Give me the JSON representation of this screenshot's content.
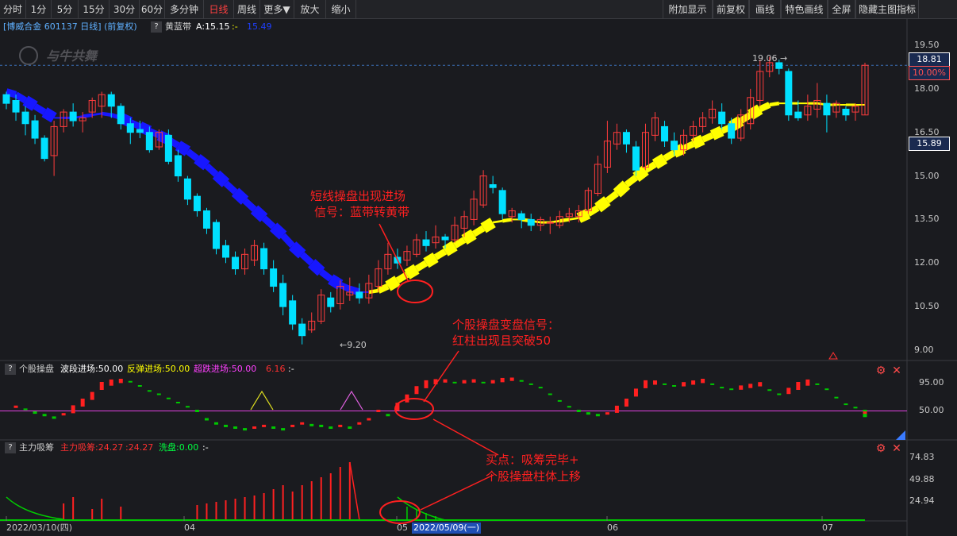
{
  "toolbar": {
    "left": [
      "分时",
      "1分",
      "5分",
      "15分",
      "30分",
      "60分",
      "多分钟",
      "日线",
      "周线",
      "更多▼",
      "放大",
      "缩小"
    ],
    "active": "日线",
    "right": [
      "附加显示",
      "前复权",
      "画线",
      "特色画线",
      "全屏",
      "隐藏主图指标"
    ]
  },
  "main": {
    "title": "[博威合金 601137 日线] (前复权)",
    "indicator": "黄蓝带",
    "a_value": "A:15.15",
    "colon": ":-",
    "last": "15.49",
    "high_label": "19.06",
    "low_label": "9.20",
    "price_tag_top": "18.81",
    "pct_tag": "10.00%",
    "price_tag_mid": "15.89",
    "axis": [
      "19.50",
      "18.00",
      "16.50",
      "15.00",
      "13.50",
      "12.00",
      "10.50",
      "9.00"
    ],
    "annot1": "短线操盘出现进场\n信号：蓝带转黄带",
    "watermark": "与牛共舞"
  },
  "panel1": {
    "name": "个股操盘",
    "a": "波段进场:50.00",
    "b": "反弹进场:50.00",
    "c": "超跌进场:50.00",
    "d": "6.16",
    "e": ":-",
    "axis": [
      "95.00",
      "50.00"
    ],
    "annot": "个股操盘变盘信号：\n红柱出现且突破50"
  },
  "panel2": {
    "name": "主力吸筹",
    "a": "主力吸筹:24.27",
    "b": ":24.27",
    "c": "洗盘:0.00",
    "d": ":-",
    "axis": [
      "74.83",
      "49.88",
      "24.94"
    ],
    "annot": "买点：吸筹完毕+\n个股操盘柱体上移"
  },
  "dates": {
    "start": "2022/03/10(四)",
    "m04": "04",
    "m05": "05",
    "cursor": "2022/05/09(一)",
    "m06": "06",
    "m07": "07"
  },
  "colors": {
    "up": "#ff3c3c",
    "down": "#00e0ff",
    "blue_band": "#1717ff",
    "yellow_band": "#ffff00",
    "magenta": "#e040e0",
    "green": "#00c800",
    "annot": "#ff2020"
  },
  "chart_data": {
    "type": "candlestick",
    "ylim": [
      8.9,
      20.0
    ],
    "candles": [
      [
        17.8,
        17.5,
        17.9,
        17.3
      ],
      [
        17.6,
        17.2,
        17.8,
        16.9
      ],
      [
        17.2,
        16.8,
        17.4,
        16.4
      ],
      [
        16.9,
        16.3,
        17.1,
        16.1
      ],
      [
        16.3,
        15.6,
        16.4,
        15.5
      ],
      [
        15.7,
        16.7,
        16.9,
        15.0
      ],
      [
        16.7,
        17.2,
        17.3,
        16.5
      ],
      [
        17.2,
        16.9,
        17.5,
        16.7
      ],
      [
        16.9,
        17.0,
        17.2,
        16.5
      ],
      [
        17.2,
        17.6,
        17.7,
        17.0
      ],
      [
        17.4,
        17.8,
        17.9,
        17.0
      ],
      [
        17.8,
        17.4,
        17.9,
        17.0
      ],
      [
        17.4,
        16.8,
        17.5,
        16.6
      ],
      [
        16.8,
        16.5,
        17.0,
        16.1
      ],
      [
        16.6,
        16.5,
        16.9,
        16.3
      ],
      [
        16.5,
        15.9,
        16.7,
        15.8
      ],
      [
        16.0,
        16.5,
        16.6,
        15.9
      ],
      [
        16.4,
        15.5,
        16.6,
        15.4
      ],
      [
        15.7,
        15.0,
        15.9,
        14.8
      ],
      [
        14.9,
        14.2,
        15.0,
        14.0
      ],
      [
        14.3,
        13.8,
        14.4,
        13.6
      ],
      [
        13.8,
        13.2,
        13.9,
        13.0
      ],
      [
        13.4,
        12.5,
        13.5,
        12.3
      ],
      [
        12.6,
        12.2,
        12.8,
        12.0
      ],
      [
        12.2,
        11.8,
        12.4,
        11.6
      ],
      [
        11.8,
        12.3,
        12.5,
        11.6
      ],
      [
        12.1,
        12.6,
        12.8,
        11.9
      ],
      [
        12.5,
        11.8,
        12.7,
        11.6
      ],
      [
        11.8,
        11.2,
        12.1,
        11.0
      ],
      [
        11.3,
        10.5,
        11.6,
        10.2
      ],
      [
        10.7,
        9.9,
        10.9,
        9.7
      ],
      [
        9.9,
        9.5,
        10.1,
        9.2
      ],
      [
        9.7,
        10.0,
        10.3,
        9.6
      ],
      [
        10.0,
        10.9,
        11.1,
        9.9
      ],
      [
        10.8,
        10.5,
        11.0,
        10.3
      ],
      [
        10.6,
        11.2,
        11.4,
        10.4
      ],
      [
        10.9,
        11.0,
        11.5,
        10.7
      ],
      [
        11.0,
        10.8,
        11.3,
        10.6
      ],
      [
        10.8,
        11.3,
        11.6,
        10.6
      ],
      [
        11.2,
        11.8,
        12.1,
        11.0
      ],
      [
        11.8,
        12.3,
        12.7,
        11.6
      ],
      [
        12.2,
        12.0,
        12.5,
        11.8
      ],
      [
        12.1,
        12.4,
        12.6,
        11.9
      ],
      [
        12.3,
        12.8,
        13.0,
        12.2
      ],
      [
        12.8,
        12.6,
        13.1,
        12.4
      ],
      [
        12.7,
        12.9,
        13.3,
        12.5
      ],
      [
        12.9,
        12.8,
        13.0,
        12.5
      ],
      [
        12.8,
        13.3,
        13.6,
        12.7
      ],
      [
        13.2,
        13.6,
        13.8,
        12.9
      ],
      [
        13.5,
        14.2,
        14.5,
        13.3
      ],
      [
        14.0,
        15.0,
        15.2,
        13.9
      ],
      [
        14.7,
        14.6,
        15.0,
        14.4
      ],
      [
        14.5,
        13.7,
        14.6,
        13.5
      ],
      [
        13.6,
        13.8,
        13.9,
        13.4
      ],
      [
        13.7,
        13.5,
        13.8,
        13.2
      ],
      [
        13.5,
        13.3,
        13.7,
        13.1
      ],
      [
        13.3,
        13.5,
        13.6,
        13.1
      ],
      [
        13.4,
        13.4,
        13.6,
        13.0
      ],
      [
        13.3,
        13.6,
        13.8,
        13.2
      ],
      [
        13.6,
        13.7,
        13.9,
        13.4
      ],
      [
        13.6,
        13.8,
        14.0,
        13.4
      ],
      [
        13.8,
        14.5,
        14.6,
        13.7
      ],
      [
        14.4,
        15.4,
        15.7,
        14.3
      ],
      [
        15.3,
        16.2,
        16.9,
        15.1
      ],
      [
        16.1,
        16.5,
        16.8,
        15.9
      ],
      [
        16.5,
        16.1,
        16.6,
        15.8
      ],
      [
        16.0,
        15.2,
        16.2,
        15.0
      ],
      [
        15.3,
        16.5,
        16.8,
        15.2
      ],
      [
        16.4,
        17.0,
        17.2,
        16.2
      ],
      [
        16.7,
        16.2,
        16.9,
        16.0
      ],
      [
        16.2,
        15.9,
        16.5,
        15.7
      ],
      [
        15.9,
        16.4,
        16.6,
        15.7
      ],
      [
        16.4,
        16.7,
        16.9,
        16.2
      ],
      [
        16.7,
        17.0,
        17.2,
        16.5
      ],
      [
        17.0,
        17.3,
        17.6,
        16.8
      ],
      [
        17.2,
        16.8,
        17.5,
        16.6
      ],
      [
        16.8,
        16.3,
        17.0,
        16.1
      ],
      [
        16.3,
        17.1,
        17.3,
        16.2
      ],
      [
        16.8,
        17.7,
        18.0,
        16.6
      ],
      [
        17.6,
        18.6,
        19.0,
        17.4
      ],
      [
        18.6,
        18.9,
        19.1,
        18.4
      ],
      [
        18.9,
        18.7,
        19.0,
        18.5
      ],
      [
        18.6,
        17.1,
        18.7,
        16.9
      ],
      [
        17.2,
        17.0,
        17.6,
        16.9
      ],
      [
        17.1,
        17.4,
        17.8,
        16.9
      ],
      [
        17.3,
        17.6,
        18.2,
        17.0
      ],
      [
        17.5,
        17.1,
        17.8,
        16.5
      ],
      [
        17.2,
        17.5,
        17.6,
        17.0
      ],
      [
        17.3,
        17.1,
        17.4,
        16.9
      ],
      [
        17.2,
        17.4,
        17.5,
        16.9
      ],
      [
        17.1,
        18.81,
        18.9,
        17.1
      ]
    ]
  }
}
